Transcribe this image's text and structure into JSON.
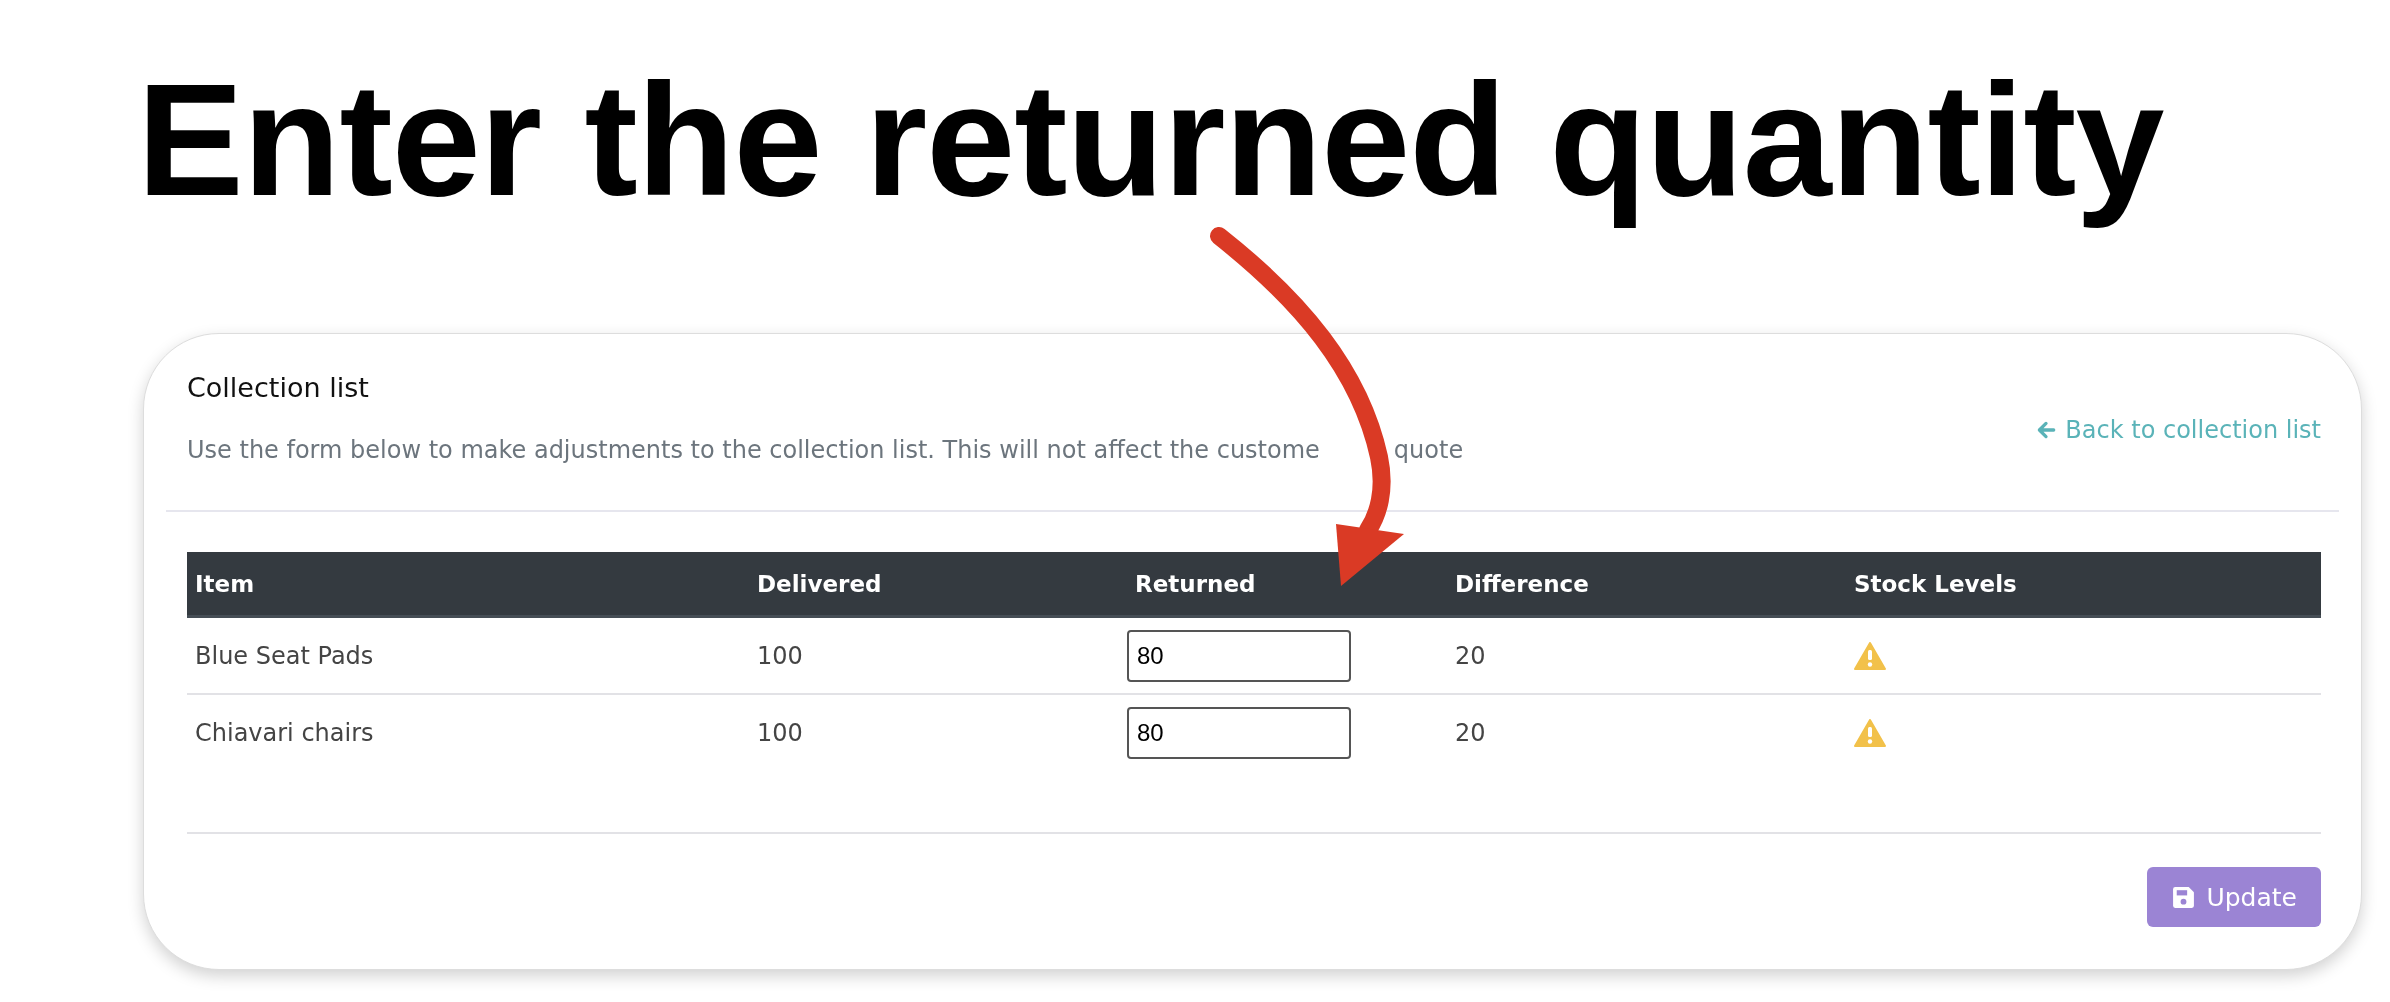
{
  "heading": "Enter the returned quantity",
  "card": {
    "title": "Collection list",
    "subtitle": [
      "Use the form below to make adjustments to the collection list. This will not affect the custome",
      "quote"
    ],
    "back_link": "Back to collection list"
  },
  "table": {
    "columns": [
      "Item",
      "Delivered",
      "Returned",
      "Difference",
      "Stock Levels"
    ],
    "rows": [
      {
        "item": "Blue Seat Pads",
        "delivered": "100",
        "returned": "80",
        "difference": "20",
        "stock_warning": true
      },
      {
        "item": "Chiavari chairs",
        "delivered": "100",
        "returned": "80",
        "difference": "20",
        "stock_warning": true
      }
    ]
  },
  "update_button": "Update"
}
